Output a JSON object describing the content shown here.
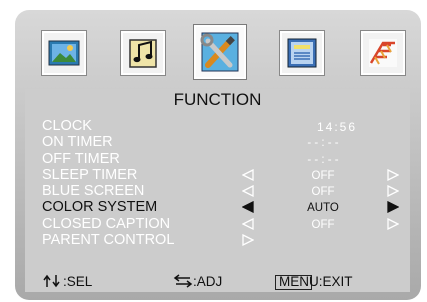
{
  "menu_tabs": [
    {
      "icon": "picture-icon"
    },
    {
      "icon": "sound-icon"
    },
    {
      "icon": "function-icon",
      "active": true
    },
    {
      "icon": "display-icon"
    },
    {
      "icon": "channel-icon"
    }
  ],
  "title": "FUNCTION",
  "items": [
    {
      "label": "CLOCK",
      "value": "14:56",
      "type": "clock"
    },
    {
      "label": "ON TIMER",
      "value": "- - : - -",
      "type": "text"
    },
    {
      "label": "OFF TIMER",
      "value": "- - : - -",
      "type": "text"
    },
    {
      "label": "SLEEP TIMER",
      "value": "OFF",
      "type": "select"
    },
    {
      "label": "BLUE SCREEN",
      "value": "OFF",
      "type": "select"
    },
    {
      "label": "COLOR SYSTEM",
      "value": "AUTO",
      "type": "select",
      "selected": true
    },
    {
      "label": "CLOSED CAPTION",
      "value": "OFF",
      "type": "select"
    },
    {
      "label": "PARENT CONTROL",
      "value": "",
      "type": "submenu"
    }
  ],
  "footer": {
    "sel": ":SEL",
    "adj": ":ADJ",
    "menu": "MENU",
    "exit": ":EXIT"
  },
  "colors": {
    "frame": "#bdbdbd",
    "panel": "#cccccc",
    "text": "#ffffff",
    "selected_text": "#111111"
  }
}
